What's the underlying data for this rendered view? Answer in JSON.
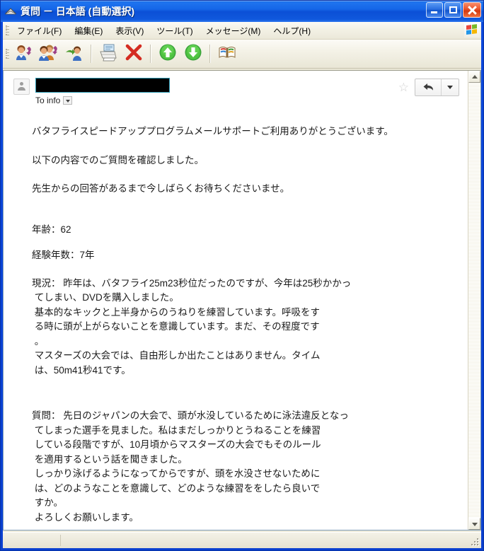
{
  "window": {
    "title": "質問  －  日本語 (自動選択)",
    "icon": "envelope-icon",
    "minimize_label": "最小化",
    "maximize_label": "最大化",
    "close_label": "閉じる",
    "frame_color": "#0a44d8",
    "titlebar_color": "#1566e8"
  },
  "menubar": {
    "items": [
      {
        "label": "ファイル(F)",
        "name": "menu-file"
      },
      {
        "label": "編集(E)",
        "name": "menu-edit"
      },
      {
        "label": "表示(V)",
        "name": "menu-view"
      },
      {
        "label": "ツール(T)",
        "name": "menu-tools"
      },
      {
        "label": "メッセージ(M)",
        "name": "menu-message"
      },
      {
        "label": "ヘルプ(H)",
        "name": "menu-help"
      }
    ]
  },
  "toolbar": {
    "buttons": [
      {
        "name": "reply-button",
        "icon": "reply-person-icon",
        "label": "返信"
      },
      {
        "name": "reply-all-button",
        "icon": "reply-all-people-icon",
        "label": "全員へ返信"
      },
      {
        "name": "forward-button",
        "icon": "forward-person-icon",
        "label": "転送"
      },
      {
        "name": "print-button",
        "icon": "printer-icon",
        "label": "印刷"
      },
      {
        "name": "delete-button",
        "icon": "red-x-icon",
        "label": "削除"
      },
      {
        "name": "previous-button",
        "icon": "green-up-arrow-icon",
        "label": "前へ"
      },
      {
        "name": "next-button",
        "icon": "green-down-arrow-icon",
        "label": "次へ"
      },
      {
        "name": "address-book-button",
        "icon": "address-book-icon",
        "label": "アドレス帳"
      }
    ]
  },
  "message_header": {
    "sender_redacted": "",
    "to_label": "To info",
    "star_icon": "star-outline-icon",
    "reply_icon": "reply-arrow-icon",
    "avatar_icon": "person-avatar-icon"
  },
  "message_body": {
    "greeting": "バタフライスピードアッププログラムメールサポートご利用ありがとうございます。",
    "confirm": "以下の内容でのご質問を確認しました。",
    "wait": "先生からの回答があるまで今しばらくお待ちくださいませ。",
    "age": "年齢：62",
    "experience": "経験年数：7年",
    "status_block": "現況： 昨年は、バタフライ25m23秒位だったのですが、今年は25秒かかっ\n てしまい、DVDを購入しました。\n 基本的なキックと上半身からのうねりを練習しています。呼吸をす\n る時に頭が上がらないことを意識しています。まだ、その程度です\n 。\n マスターズの大会では、自由形しか出たことはありません。タイム\n は、50m41秒41です。",
    "question_block": "質問： 先日のジャパンの大会で、頭が水没しているために泳法違反となっ\n てしまった選手を見ました。私はまだしっかりとうねることを練習\n している段階ですが、10月頃からマスターズの大会でもそのルール\n を適用するという話を聞きました。\n しっかり泳げるようになってからですが、頭を水没させないために\n は、どのようなことを意識して、どのような練習ををしたら良いで\n すか。\n よろしくお願いします。"
  },
  "scrollbar": {
    "up_name": "scroll-up-button",
    "down_name": "scroll-down-button"
  },
  "statusbar": {
    "text": ""
  }
}
